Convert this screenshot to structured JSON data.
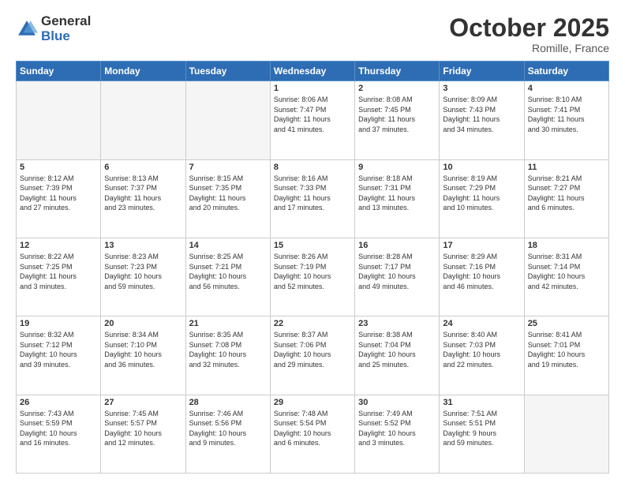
{
  "logo": {
    "general": "General",
    "blue": "Blue"
  },
  "header": {
    "title": "October 2025",
    "subtitle": "Romille, France"
  },
  "weekdays": [
    "Sunday",
    "Monday",
    "Tuesday",
    "Wednesday",
    "Thursday",
    "Friday",
    "Saturday"
  ],
  "weeks": [
    [
      {
        "day": "",
        "info": ""
      },
      {
        "day": "",
        "info": ""
      },
      {
        "day": "",
        "info": ""
      },
      {
        "day": "1",
        "info": "Sunrise: 8:06 AM\nSunset: 7:47 PM\nDaylight: 11 hours\nand 41 minutes."
      },
      {
        "day": "2",
        "info": "Sunrise: 8:08 AM\nSunset: 7:45 PM\nDaylight: 11 hours\nand 37 minutes."
      },
      {
        "day": "3",
        "info": "Sunrise: 8:09 AM\nSunset: 7:43 PM\nDaylight: 11 hours\nand 34 minutes."
      },
      {
        "day": "4",
        "info": "Sunrise: 8:10 AM\nSunset: 7:41 PM\nDaylight: 11 hours\nand 30 minutes."
      }
    ],
    [
      {
        "day": "5",
        "info": "Sunrise: 8:12 AM\nSunset: 7:39 PM\nDaylight: 11 hours\nand 27 minutes."
      },
      {
        "day": "6",
        "info": "Sunrise: 8:13 AM\nSunset: 7:37 PM\nDaylight: 11 hours\nand 23 minutes."
      },
      {
        "day": "7",
        "info": "Sunrise: 8:15 AM\nSunset: 7:35 PM\nDaylight: 11 hours\nand 20 minutes."
      },
      {
        "day": "8",
        "info": "Sunrise: 8:16 AM\nSunset: 7:33 PM\nDaylight: 11 hours\nand 17 minutes."
      },
      {
        "day": "9",
        "info": "Sunrise: 8:18 AM\nSunset: 7:31 PM\nDaylight: 11 hours\nand 13 minutes."
      },
      {
        "day": "10",
        "info": "Sunrise: 8:19 AM\nSunset: 7:29 PM\nDaylight: 11 hours\nand 10 minutes."
      },
      {
        "day": "11",
        "info": "Sunrise: 8:21 AM\nSunset: 7:27 PM\nDaylight: 11 hours\nand 6 minutes."
      }
    ],
    [
      {
        "day": "12",
        "info": "Sunrise: 8:22 AM\nSunset: 7:25 PM\nDaylight: 11 hours\nand 3 minutes."
      },
      {
        "day": "13",
        "info": "Sunrise: 8:23 AM\nSunset: 7:23 PM\nDaylight: 10 hours\nand 59 minutes."
      },
      {
        "day": "14",
        "info": "Sunrise: 8:25 AM\nSunset: 7:21 PM\nDaylight: 10 hours\nand 56 minutes."
      },
      {
        "day": "15",
        "info": "Sunrise: 8:26 AM\nSunset: 7:19 PM\nDaylight: 10 hours\nand 52 minutes."
      },
      {
        "day": "16",
        "info": "Sunrise: 8:28 AM\nSunset: 7:17 PM\nDaylight: 10 hours\nand 49 minutes."
      },
      {
        "day": "17",
        "info": "Sunrise: 8:29 AM\nSunset: 7:16 PM\nDaylight: 10 hours\nand 46 minutes."
      },
      {
        "day": "18",
        "info": "Sunrise: 8:31 AM\nSunset: 7:14 PM\nDaylight: 10 hours\nand 42 minutes."
      }
    ],
    [
      {
        "day": "19",
        "info": "Sunrise: 8:32 AM\nSunset: 7:12 PM\nDaylight: 10 hours\nand 39 minutes."
      },
      {
        "day": "20",
        "info": "Sunrise: 8:34 AM\nSunset: 7:10 PM\nDaylight: 10 hours\nand 36 minutes."
      },
      {
        "day": "21",
        "info": "Sunrise: 8:35 AM\nSunset: 7:08 PM\nDaylight: 10 hours\nand 32 minutes."
      },
      {
        "day": "22",
        "info": "Sunrise: 8:37 AM\nSunset: 7:06 PM\nDaylight: 10 hours\nand 29 minutes."
      },
      {
        "day": "23",
        "info": "Sunrise: 8:38 AM\nSunset: 7:04 PM\nDaylight: 10 hours\nand 25 minutes."
      },
      {
        "day": "24",
        "info": "Sunrise: 8:40 AM\nSunset: 7:03 PM\nDaylight: 10 hours\nand 22 minutes."
      },
      {
        "day": "25",
        "info": "Sunrise: 8:41 AM\nSunset: 7:01 PM\nDaylight: 10 hours\nand 19 minutes."
      }
    ],
    [
      {
        "day": "26",
        "info": "Sunrise: 7:43 AM\nSunset: 5:59 PM\nDaylight: 10 hours\nand 16 minutes."
      },
      {
        "day": "27",
        "info": "Sunrise: 7:45 AM\nSunset: 5:57 PM\nDaylight: 10 hours\nand 12 minutes."
      },
      {
        "day": "28",
        "info": "Sunrise: 7:46 AM\nSunset: 5:56 PM\nDaylight: 10 hours\nand 9 minutes."
      },
      {
        "day": "29",
        "info": "Sunrise: 7:48 AM\nSunset: 5:54 PM\nDaylight: 10 hours\nand 6 minutes."
      },
      {
        "day": "30",
        "info": "Sunrise: 7:49 AM\nSunset: 5:52 PM\nDaylight: 10 hours\nand 3 minutes."
      },
      {
        "day": "31",
        "info": "Sunrise: 7:51 AM\nSunset: 5:51 PM\nDaylight: 9 hours\nand 59 minutes."
      },
      {
        "day": "",
        "info": ""
      }
    ]
  ]
}
